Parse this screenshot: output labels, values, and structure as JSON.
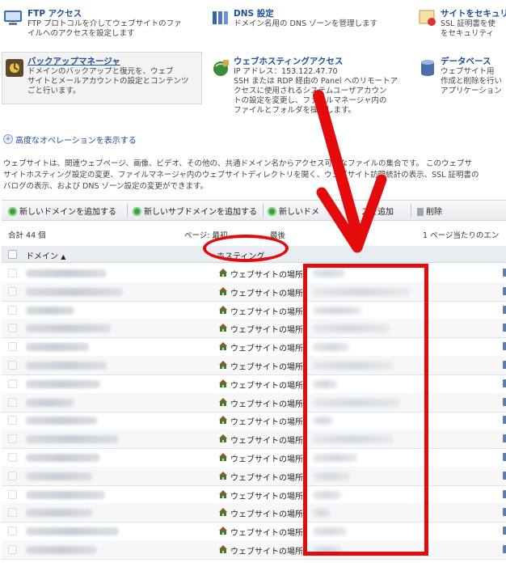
{
  "features": [
    {
      "title": "FTP アクセス",
      "desc": "FTP プロトコルを介してウェブサイトのファ\nイルへのアクセスを設定します",
      "icon": "ftp-icon"
    },
    {
      "title": "DNS 設定",
      "desc": "ドメイン名用の DNS ゾーンを管理します",
      "icon": "dns-settings-icon"
    },
    {
      "title": "サイトをセキュリ",
      "desc": "SSL 証明書を使\nをセキュリティ",
      "icon": "security-icon"
    },
    {
      "title": "バックアップマネージャ",
      "desc": "ドメインのバックアップと復元を、ウェブ\nサイトとメールアカウントの設定とコンテンツ\nごと行います。",
      "icon": "backup-icon"
    },
    {
      "title": "ウェブホスティングアクセス",
      "desc": "IP アドレス：153.122.47.70\nSSH または RDP 経由の Panel へのリモートア\nクセスに使用されるシステムユーザアカウン\nトの設定を変更し、ファイルマネージャ内の\nファイルとフォルダを操作します。",
      "icon": "web-hosting-icon"
    },
    {
      "title": "データベース",
      "desc": "ウェブサイト用\n作成と削除を行い\nアプリケーション",
      "icon": "database-icon"
    }
  ],
  "advanced_link": "高度なオペレーションを表示する",
  "description": "ウェブサイトは、関連ウェブページ、画像、ビデオ、その他の、共通ドメイン名からアクセス可能なファイルの集合です。 このウェブサ\nサイトホスティング設定の変更、ファイルマネージャ内のウェブサイトディレクトリを開く、ウェブサイト訪問統計の表示、SSL 証明書の\nバログの表示、および DNS ゾーン設定の変更ができます。",
  "toolbar": {
    "add_domain": "新しいドメインを追加する",
    "add_subdomain": "新しいサブドメインを追加する",
    "add_alias": "新しいドメ",
    "add_alias_tail": "スを追加",
    "delete": "削除"
  },
  "list_meta": {
    "total": "合計 44 個",
    "pagination": "ページ: 最初",
    "pagination_tail": "最後",
    "per_page": "1 ページ当たりのエン"
  },
  "table": {
    "col_domain": "ドメイン",
    "sort_indicator": "▲",
    "col_hosting": "ホスティング",
    "hosting_value": "ウェブサイトの場所",
    "row_count": 16
  },
  "colors": {
    "annotation": "#e30b0b",
    "link": "#1e4e9c"
  }
}
